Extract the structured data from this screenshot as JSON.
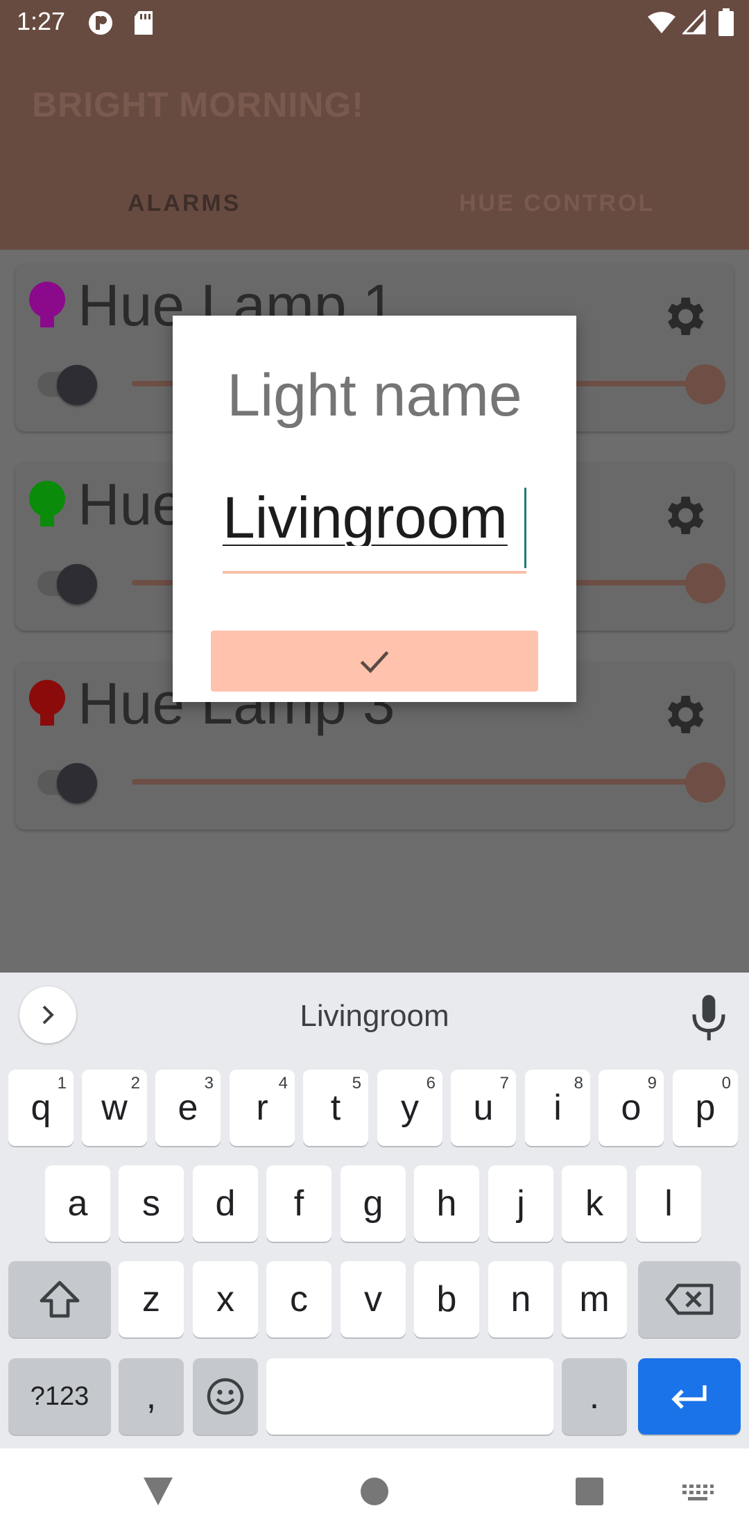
{
  "status_bar": {
    "time": "1:27"
  },
  "app_bar": {
    "title": "BRIGHT MORNING!",
    "tabs": [
      "ALARMS",
      "HUE CONTROL"
    ]
  },
  "lamps": [
    {
      "name": "Hue Lamp 1",
      "color": "#8b0a8b"
    },
    {
      "name": "Hue Lamp 2",
      "color": "#0a8b0a"
    },
    {
      "name": "Hue Lamp 3",
      "color": "#8b0a0a"
    }
  ],
  "dialog": {
    "title": "Light name",
    "input_value": "Livingroom",
    "confirm_icon": "check-icon"
  },
  "keyboard": {
    "suggestion": "Livingroom",
    "row1": [
      "q",
      "w",
      "e",
      "r",
      "t",
      "y",
      "u",
      "i",
      "o",
      "p"
    ],
    "row1_hints": [
      "1",
      "2",
      "3",
      "4",
      "5",
      "6",
      "7",
      "8",
      "9",
      "0"
    ],
    "row2": [
      "a",
      "s",
      "d",
      "f",
      "g",
      "h",
      "j",
      "k",
      "l"
    ],
    "row3": [
      "z",
      "x",
      "c",
      "v",
      "b",
      "n",
      "m"
    ],
    "symbols_label": "?123",
    "comma": ",",
    "period": "."
  },
  "colors": {
    "accent": "#ffc2ad",
    "app_bar": "#684b40",
    "enter_key": "#1a73e8"
  }
}
